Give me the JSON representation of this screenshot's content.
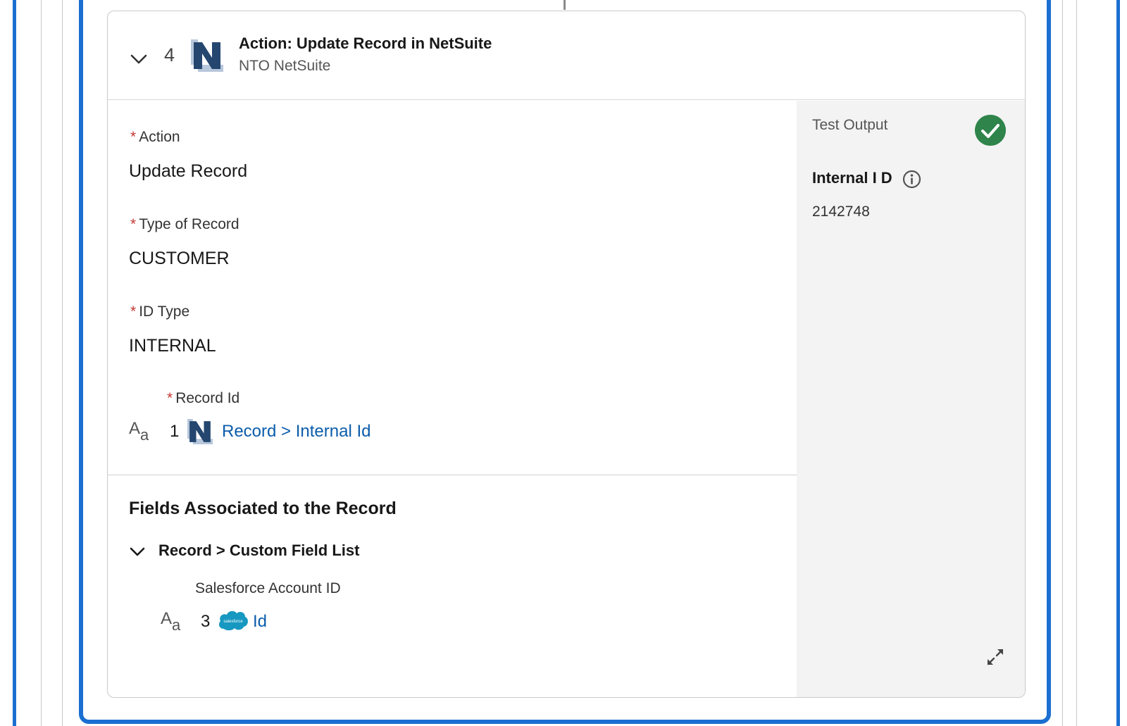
{
  "step": {
    "number": "4",
    "title": "Action: Update Record in NetSuite",
    "connection": "NTO NetSuite"
  },
  "fields": {
    "action": {
      "label": "Action",
      "value": "Update Record"
    },
    "record_type": {
      "label": "Type of Record",
      "value": "CUSTOMER"
    },
    "id_type": {
      "label": "ID Type",
      "value": "INTERNAL"
    },
    "record_id": {
      "label": "Record Id",
      "mapped_step": "1",
      "mapped_value": "Record > Internal Id"
    }
  },
  "associated_fields": {
    "title": "Fields Associated to the Record",
    "group_label": "Record > Custom Field List",
    "items": [
      {
        "label": "Salesforce Account ID",
        "mapped_step": "3",
        "mapped_value": "Id"
      }
    ]
  },
  "test_output": {
    "label": "Test Output",
    "status": "success",
    "field_label": "Internal I D",
    "field_value": "2142748"
  },
  "icons": {
    "type_icon": "A a",
    "salesforce_logo_text": "salesforce"
  },
  "colors": {
    "accent": "#1b6fd0",
    "link": "#0b5cab",
    "required": "#c23934",
    "success": "#2e844a",
    "netsuite_dark": "#24466f",
    "netsuite_light": "#b7c7dc",
    "salesforce_blue": "#1798c1"
  }
}
